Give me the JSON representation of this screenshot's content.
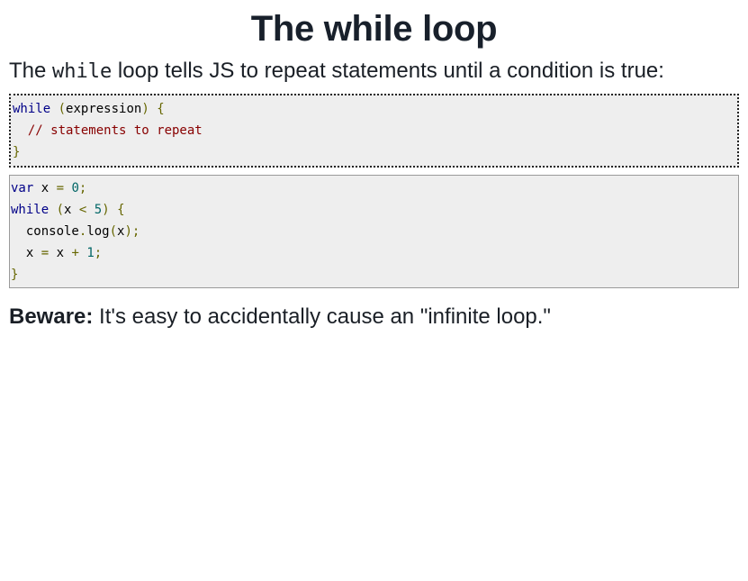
{
  "heading": "The while loop",
  "intro": {
    "before": "The ",
    "code": "while",
    "after": " loop tells JS to repeat statements until a condition is true:"
  },
  "syntax_block": {
    "line1": {
      "kw": "while",
      "sp": " ",
      "open_paren": "(",
      "expr": "expression",
      "close_paren": ")",
      "sp2": " ",
      "brace": "{"
    },
    "line2": {
      "indent": "  ",
      "comment": "// statements to repeat"
    },
    "line3": {
      "brace": "}"
    }
  },
  "example_block": {
    "line1": {
      "kw": "var",
      "sp": " ",
      "name": "x",
      "sp2": " ",
      "eq": "=",
      "sp3": " ",
      "num": "0",
      "semi": ";"
    },
    "line2": {
      "kw": "while",
      "sp": " ",
      "open_paren": "(",
      "name": "x",
      "sp2": " ",
      "op": "<",
      "sp3": " ",
      "num": "5",
      "close_paren": ")",
      "sp4": " ",
      "brace": "{"
    },
    "line3": {
      "indent": "  ",
      "obj": "console",
      "dot": ".",
      "fn": "log",
      "open_paren": "(",
      "arg": "x",
      "close_paren": ")",
      "semi": ";"
    },
    "line4": {
      "indent": "  ",
      "name": "x",
      "sp": " ",
      "eq": "=",
      "sp2": " ",
      "name2": "x",
      "sp3": " ",
      "op": "+",
      "sp4": " ",
      "num": "1",
      "semi": ";"
    },
    "line5": {
      "brace": "}"
    }
  },
  "beware": {
    "label": "Beware:",
    "text": " It's easy to accidentally cause an \"infinite loop.\""
  },
  "colors": {
    "keyword": "#000088",
    "punctuation": "#666600",
    "comment": "#880000",
    "literal": "#006666",
    "code_background": "#eeeeee",
    "text": "#1a1f26"
  }
}
